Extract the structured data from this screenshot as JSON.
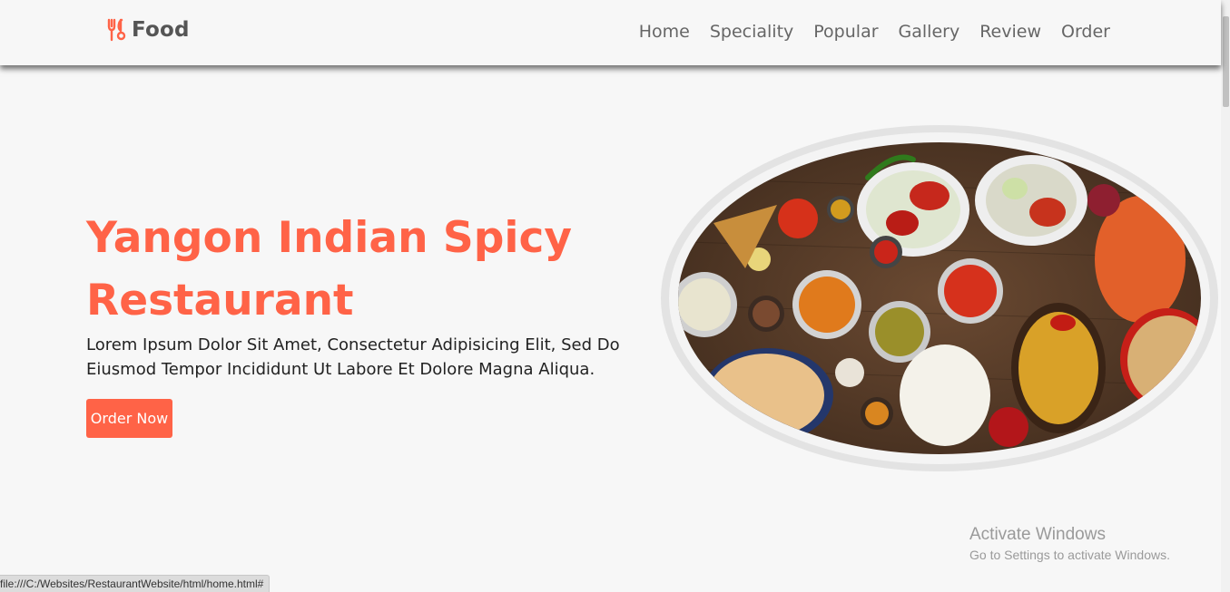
{
  "header": {
    "logo_text": "Food",
    "nav": [
      {
        "label": "Home"
      },
      {
        "label": "Speciality"
      },
      {
        "label": "Popular"
      },
      {
        "label": "Gallery"
      },
      {
        "label": "Review"
      },
      {
        "label": "Order"
      }
    ]
  },
  "hero": {
    "title": "Yangon Indian Spicy Restaurant",
    "description": "Lorem Ipsum Dolor Sit Amet, Consectetur Adipisicing Elit, Sed Do Eiusmod Tempor Incididunt Ut Labore Et Dolore Magna Aliqua.",
    "cta_label": "Order Now"
  },
  "watermark": {
    "title": "Activate Windows",
    "subtitle": "Go to Settings to activate Windows."
  },
  "status_bar": {
    "url": "file:///C:/Websites/RestaurantWebsite/html/home.html#"
  },
  "colors": {
    "accent": "#ff6347",
    "background": "#f7f7f7",
    "nav_text": "#666666"
  }
}
